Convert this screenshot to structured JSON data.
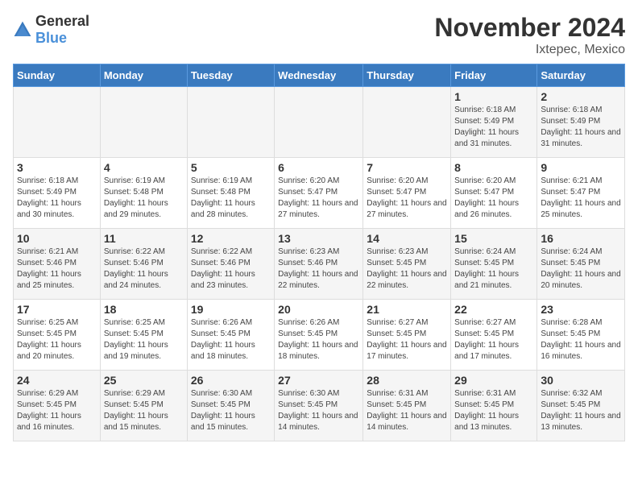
{
  "logo": {
    "text_general": "General",
    "text_blue": "Blue"
  },
  "title": "November 2024",
  "location": "Ixtepec, Mexico",
  "headers": [
    "Sunday",
    "Monday",
    "Tuesday",
    "Wednesday",
    "Thursday",
    "Friday",
    "Saturday"
  ],
  "weeks": [
    [
      {
        "day": "",
        "info": ""
      },
      {
        "day": "",
        "info": ""
      },
      {
        "day": "",
        "info": ""
      },
      {
        "day": "",
        "info": ""
      },
      {
        "day": "",
        "info": ""
      },
      {
        "day": "1",
        "info": "Sunrise: 6:18 AM\nSunset: 5:49 PM\nDaylight: 11 hours and 31 minutes."
      },
      {
        "day": "2",
        "info": "Sunrise: 6:18 AM\nSunset: 5:49 PM\nDaylight: 11 hours and 31 minutes."
      }
    ],
    [
      {
        "day": "3",
        "info": "Sunrise: 6:18 AM\nSunset: 5:49 PM\nDaylight: 11 hours and 30 minutes."
      },
      {
        "day": "4",
        "info": "Sunrise: 6:19 AM\nSunset: 5:48 PM\nDaylight: 11 hours and 29 minutes."
      },
      {
        "day": "5",
        "info": "Sunrise: 6:19 AM\nSunset: 5:48 PM\nDaylight: 11 hours and 28 minutes."
      },
      {
        "day": "6",
        "info": "Sunrise: 6:20 AM\nSunset: 5:47 PM\nDaylight: 11 hours and 27 minutes."
      },
      {
        "day": "7",
        "info": "Sunrise: 6:20 AM\nSunset: 5:47 PM\nDaylight: 11 hours and 27 minutes."
      },
      {
        "day": "8",
        "info": "Sunrise: 6:20 AM\nSunset: 5:47 PM\nDaylight: 11 hours and 26 minutes."
      },
      {
        "day": "9",
        "info": "Sunrise: 6:21 AM\nSunset: 5:47 PM\nDaylight: 11 hours and 25 minutes."
      }
    ],
    [
      {
        "day": "10",
        "info": "Sunrise: 6:21 AM\nSunset: 5:46 PM\nDaylight: 11 hours and 25 minutes."
      },
      {
        "day": "11",
        "info": "Sunrise: 6:22 AM\nSunset: 5:46 PM\nDaylight: 11 hours and 24 minutes."
      },
      {
        "day": "12",
        "info": "Sunrise: 6:22 AM\nSunset: 5:46 PM\nDaylight: 11 hours and 23 minutes."
      },
      {
        "day": "13",
        "info": "Sunrise: 6:23 AM\nSunset: 5:46 PM\nDaylight: 11 hours and 22 minutes."
      },
      {
        "day": "14",
        "info": "Sunrise: 6:23 AM\nSunset: 5:45 PM\nDaylight: 11 hours and 22 minutes."
      },
      {
        "day": "15",
        "info": "Sunrise: 6:24 AM\nSunset: 5:45 PM\nDaylight: 11 hours and 21 minutes."
      },
      {
        "day": "16",
        "info": "Sunrise: 6:24 AM\nSunset: 5:45 PM\nDaylight: 11 hours and 20 minutes."
      }
    ],
    [
      {
        "day": "17",
        "info": "Sunrise: 6:25 AM\nSunset: 5:45 PM\nDaylight: 11 hours and 20 minutes."
      },
      {
        "day": "18",
        "info": "Sunrise: 6:25 AM\nSunset: 5:45 PM\nDaylight: 11 hours and 19 minutes."
      },
      {
        "day": "19",
        "info": "Sunrise: 6:26 AM\nSunset: 5:45 PM\nDaylight: 11 hours and 18 minutes."
      },
      {
        "day": "20",
        "info": "Sunrise: 6:26 AM\nSunset: 5:45 PM\nDaylight: 11 hours and 18 minutes."
      },
      {
        "day": "21",
        "info": "Sunrise: 6:27 AM\nSunset: 5:45 PM\nDaylight: 11 hours and 17 minutes."
      },
      {
        "day": "22",
        "info": "Sunrise: 6:27 AM\nSunset: 5:45 PM\nDaylight: 11 hours and 17 minutes."
      },
      {
        "day": "23",
        "info": "Sunrise: 6:28 AM\nSunset: 5:45 PM\nDaylight: 11 hours and 16 minutes."
      }
    ],
    [
      {
        "day": "24",
        "info": "Sunrise: 6:29 AM\nSunset: 5:45 PM\nDaylight: 11 hours and 16 minutes."
      },
      {
        "day": "25",
        "info": "Sunrise: 6:29 AM\nSunset: 5:45 PM\nDaylight: 11 hours and 15 minutes."
      },
      {
        "day": "26",
        "info": "Sunrise: 6:30 AM\nSunset: 5:45 PM\nDaylight: 11 hours and 15 minutes."
      },
      {
        "day": "27",
        "info": "Sunrise: 6:30 AM\nSunset: 5:45 PM\nDaylight: 11 hours and 14 minutes."
      },
      {
        "day": "28",
        "info": "Sunrise: 6:31 AM\nSunset: 5:45 PM\nDaylight: 11 hours and 14 minutes."
      },
      {
        "day": "29",
        "info": "Sunrise: 6:31 AM\nSunset: 5:45 PM\nDaylight: 11 hours and 13 minutes."
      },
      {
        "day": "30",
        "info": "Sunrise: 6:32 AM\nSunset: 5:45 PM\nDaylight: 11 hours and 13 minutes."
      }
    ]
  ]
}
